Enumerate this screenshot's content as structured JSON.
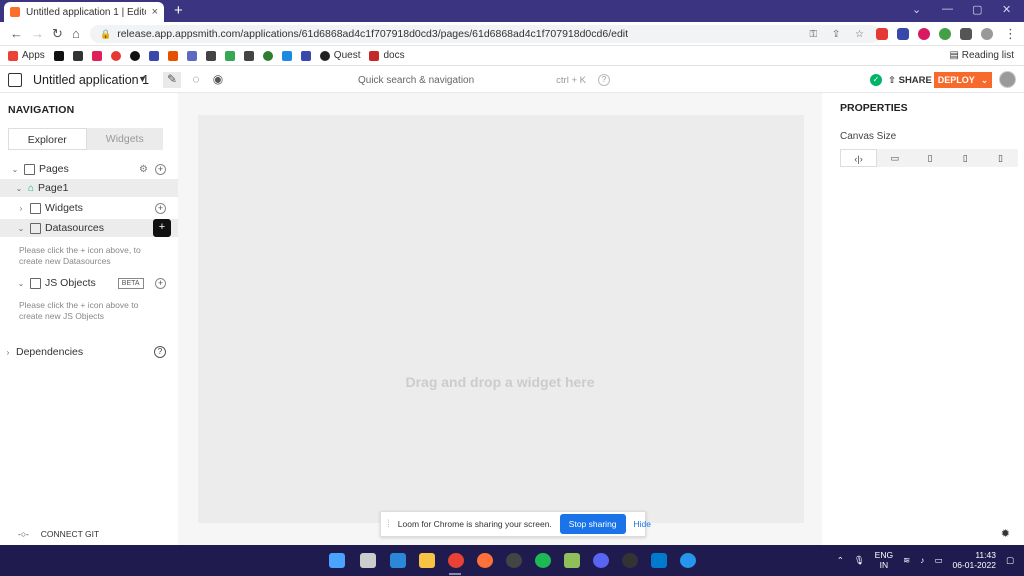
{
  "browser": {
    "tab_title": "Untitled application 1 | Editor | A",
    "new_tab": "+",
    "url": "release.app.appsmith.com/applications/61d6868ad4c1f707918d0cd3/pages/61d6868ad4c1f707918d0cd6/edit",
    "bookmarks": [
      "Apps",
      "Quest",
      "docs"
    ],
    "reading_list": "Reading list"
  },
  "header": {
    "app_title": "Untitled application 1",
    "search_placeholder": "Quick search & navigation",
    "search_shortcut": "ctrl + K",
    "share_label": "SHARE",
    "deploy_label": "DEPLOY"
  },
  "navigation": {
    "title": "NAVIGATION",
    "tabs": [
      "Explorer",
      "Widgets"
    ],
    "pages_label": "Pages",
    "page1_label": "Page1",
    "widgets_label": "Widgets",
    "datasources_label": "Datasources",
    "datasources_hint": "Please click the + icon above, to create new Datasources",
    "jsobjects_label": "JS Objects",
    "beta_label": "BETA",
    "jsobjects_hint": "Please click the + icon above to create new JS Objects",
    "dependencies_label": "Dependencies",
    "connect_git": "CONNECT GIT"
  },
  "canvas": {
    "empty_message": "Drag and drop a widget here"
  },
  "loom": {
    "message": "Loom for Chrome is sharing your screen.",
    "stop_label": "Stop sharing",
    "hide_label": "Hide"
  },
  "properties": {
    "title": "PROPERTIES",
    "canvas_size_label": "Canvas Size"
  },
  "taskbar": {
    "lang_top": "ENG",
    "lang_bottom": "IN",
    "time": "11:43",
    "date": "06-01-2022"
  },
  "colors": {
    "accent": "#f86a2b",
    "titlebar": "#3b3480",
    "taskbar": "#1f1b4f",
    "loom_button": "#1a73e8"
  }
}
